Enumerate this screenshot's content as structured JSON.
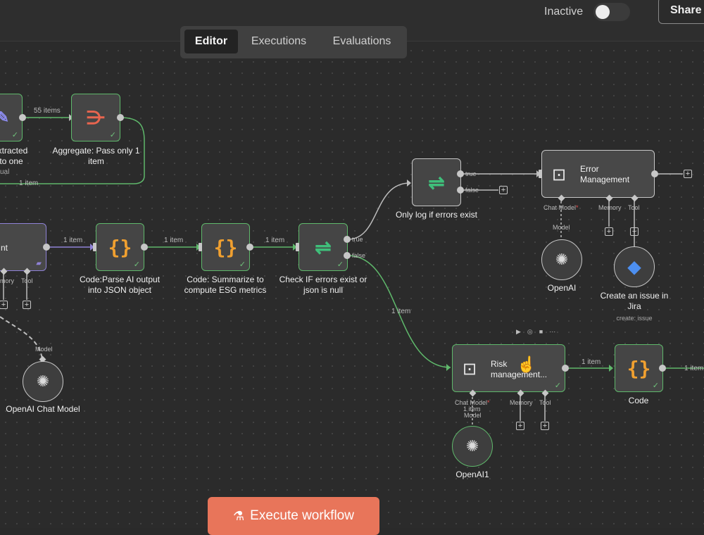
{
  "topbar": {
    "status_label": "Inactive",
    "share_label": "Share"
  },
  "tabs": [
    {
      "label": "Editor",
      "active": true
    },
    {
      "label": "Executions",
      "active": false
    },
    {
      "label": "Evaluations",
      "active": false
    }
  ],
  "nodes": {
    "extracted": {
      "title_line1": "extracted",
      "title_line2": "into one",
      "subtitle": "ual"
    },
    "aggregate": {
      "title_line1": "Aggregate: Pass only 1",
      "title_line2": "item"
    },
    "agent_left": {
      "title": "nt"
    },
    "code_parse": {
      "title_line1": "Code:Parse AI output",
      "title_line2": "into JSON object"
    },
    "code_summarize": {
      "title_line1": "Code: Summarize to",
      "title_line2": "compute ESG metrics"
    },
    "check_if": {
      "title_line1": "Check IF errors exist or",
      "title_line2": "json is null"
    },
    "only_log": {
      "title": "Only log if errors exist"
    },
    "error_mgmt": {
      "title_line1": "Error",
      "title_line2": "Management"
    },
    "openai": {
      "title": "OpenAI"
    },
    "jira": {
      "title_line1": "Create an issue in",
      "title_line2": "Jira",
      "subtitle": "create: issue"
    },
    "risk_mgmt": {
      "title_line1": "Risk",
      "title_line2": "management..."
    },
    "code_right": {
      "title": "Code"
    },
    "openai1": {
      "title": "OpenAI1"
    },
    "openai_chat": {
      "title": "OpenAI Chat Model"
    }
  },
  "connection_labels": {
    "items_55": "55 items",
    "item_loop": "1 item",
    "item_a": "1 item",
    "item_b": "1 item",
    "item_c": "1 item",
    "item_false": "1 item",
    "item_risk": "1 item",
    "item_end": "1 item",
    "item_risk_chat": "1 item"
  },
  "branch_labels": {
    "true": "true",
    "false": "false",
    "true2": "true",
    "false2": "false"
  },
  "port_labels": {
    "chat_model": "Chat Model",
    "memory": "Memory",
    "tool": "Tool",
    "model": "Model",
    "left_memory": "mory",
    "left_tool": "Tool",
    "risk_chat_model": "Chat Model",
    "risk_memory": "Memory",
    "risk_tool": "Tool",
    "risk_model": "Model",
    "chat_model_left": "Model"
  },
  "execute_button": {
    "label": "Execute workflow"
  },
  "colors": {
    "accent": "#e8755a",
    "success": "#5fb86b",
    "brace_icon": "#f0a030",
    "jira": "#4d8ff0",
    "trigger_icon": "#3fbf7a"
  }
}
